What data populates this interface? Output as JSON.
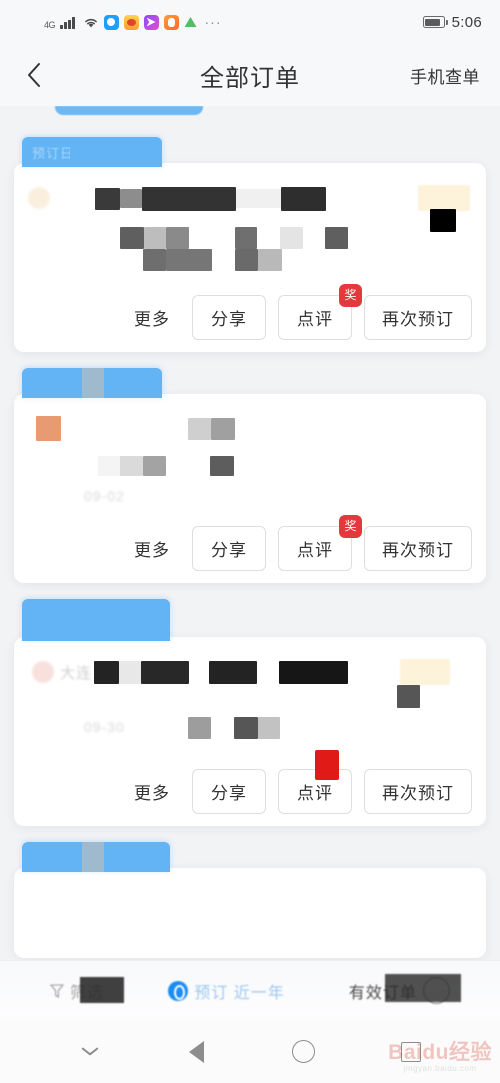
{
  "status_bar": {
    "network_type": "4G",
    "icons": [
      "signal-icon",
      "wifi-icon",
      "app-icon-blue",
      "app-icon-orange",
      "app-icon-purple",
      "app-icon-orange2",
      "app-icon-green",
      "overflow-dots"
    ],
    "overflow": "···",
    "time": "5:06",
    "battery_level_label": ""
  },
  "header": {
    "back_icon": "chevron-left-icon",
    "title": "全部订单",
    "right_link": "手机查单"
  },
  "orders": [
    {
      "tag_label": "预订日期",
      "title_redacted": true,
      "date_text": "",
      "actions": {
        "more": "更多",
        "share": "分享",
        "review": "点评",
        "rebook": "再次预订",
        "review_badge": "奖"
      }
    },
    {
      "tag_label": "",
      "title_redacted": true,
      "date_text": "09-02",
      "actions": {
        "more": "更多",
        "share": "分享",
        "review": "点评",
        "rebook": "再次预订",
        "review_badge": "奖"
      }
    },
    {
      "tag_label": "",
      "title_redacted": true,
      "date_text": "09-30",
      "actions": {
        "more": "更多",
        "share": "分享",
        "review": "点评",
        "rebook": "再次预订",
        "review_badge": ""
      }
    },
    {
      "tag_label": "",
      "title_redacted": true,
      "date_text": "",
      "actions": {}
    }
  ],
  "filter_bar": {
    "filter_icon": "funnel-icon",
    "filter_label": "筛选",
    "middle_icon": "clock-icon",
    "middle_label": "预订 近一年",
    "valid_label": "有效订单",
    "valid_toggle": "circle-toggle"
  },
  "system_nav": {
    "hide_keyboard_icon": "chevron-down-icon",
    "back_icon": "triangle-back-icon",
    "home_icon": "circle-home-icon",
    "recents_icon": "square-recents-icon"
  },
  "watermark": {
    "brand": "Baidu",
    "brand_suffix": "经验",
    "domain": "jingyan.baidu.com"
  },
  "colors": {
    "tag_blue": "#62b4f5",
    "badge_red": "#e4393c",
    "page_bg": "#f2f3f5",
    "card_bg": "#ffffff"
  }
}
